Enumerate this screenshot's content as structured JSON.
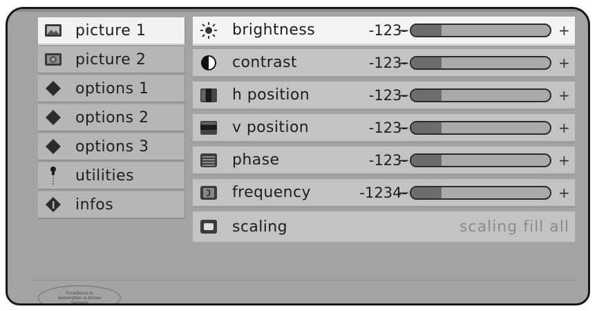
{
  "menu": {
    "items": [
      {
        "label": "picture 1",
        "icon": "picture-icon",
        "active": true
      },
      {
        "label": "picture 2",
        "icon": "picture-2-icon",
        "active": false
      },
      {
        "label": "options 1",
        "icon": "diamond-icon",
        "active": false
      },
      {
        "label": "options 2",
        "icon": "diamond-icon",
        "active": false
      },
      {
        "label": "options 3",
        "icon": "diamond-icon",
        "active": false
      },
      {
        "label": "utilities",
        "icon": "wrench-icon",
        "active": false
      },
      {
        "label": "infos",
        "icon": "info-icon",
        "active": false
      }
    ]
  },
  "settings": {
    "rows": [
      {
        "label": "brightness",
        "icon": "sun-icon",
        "value": "-123-",
        "minus": "−",
        "plus": "+",
        "level": 0.22
      },
      {
        "label": "contrast",
        "icon": "contrast-icon",
        "value": "-123-",
        "minus": "−",
        "plus": "+",
        "level": 0.22
      },
      {
        "label": "h position",
        "icon": "h-position-icon",
        "value": "-123-",
        "minus": "−",
        "plus": "+",
        "level": 0.22
      },
      {
        "label": "v position",
        "icon": "v-position-icon",
        "value": "-123-",
        "minus": "−",
        "plus": "+",
        "level": 0.22
      },
      {
        "label": "phase",
        "icon": "phase-icon",
        "value": "-123-",
        "minus": "−",
        "plus": "+",
        "level": 0.22
      },
      {
        "label": "frequency",
        "icon": "frequency-icon",
        "value": "-1234-",
        "minus": "−",
        "plus": "+",
        "level": 0.22
      }
    ],
    "scaling": {
      "label": "scaling",
      "icon": "scaling-icon",
      "value": "scaling fill all"
    }
  },
  "footer": {
    "logo_lines": [
      "Excellence in",
      "Automation & Drives",
      "Siemens"
    ]
  }
}
